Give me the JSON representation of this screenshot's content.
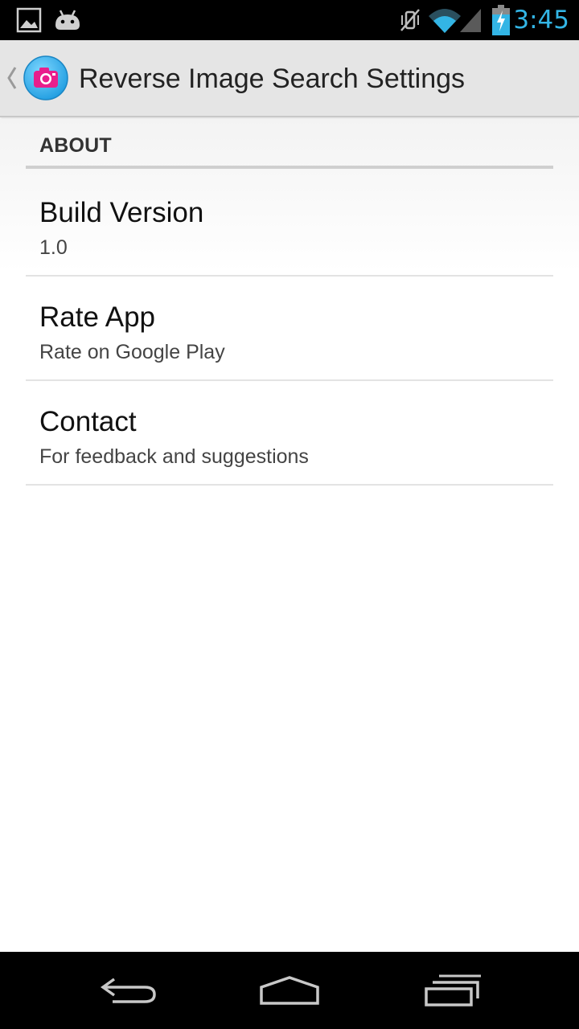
{
  "status_bar": {
    "time": "3:45",
    "time_color": "#33b5e5",
    "left_icons": [
      "gallery-notification-icon",
      "android-notification-icon"
    ],
    "right_icons": [
      "vibrate-mute-icon",
      "wifi-icon",
      "signal-icon",
      "battery-charging-icon"
    ]
  },
  "action_bar": {
    "title": "Reverse Image Search Settings",
    "logo_icon": "camera-icon",
    "logo_color": "#29b6f6",
    "camera_color": "#e91e8c"
  },
  "settings": {
    "category": "ABOUT",
    "items": [
      {
        "title": "Build Version",
        "summary": "1.0"
      },
      {
        "title": "Rate App",
        "summary": "Rate on Google Play"
      },
      {
        "title": "Contact",
        "summary": "For feedback and suggestions"
      }
    ]
  },
  "nav_bar": {
    "buttons": [
      "back-icon",
      "home-icon",
      "recent-apps-icon"
    ]
  }
}
